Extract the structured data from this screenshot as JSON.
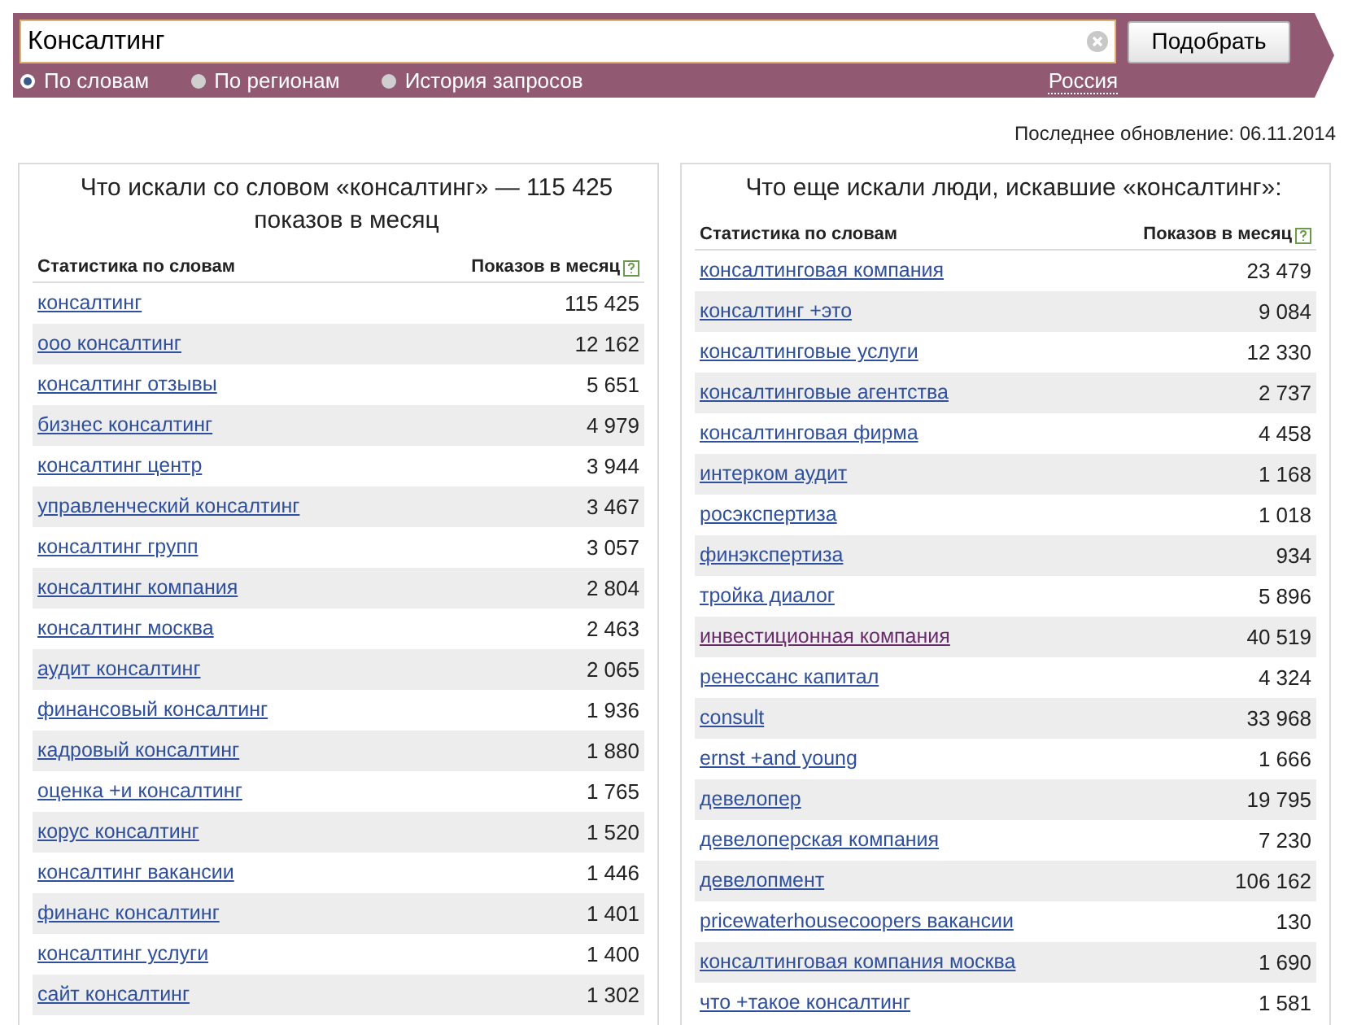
{
  "search": {
    "value": "Консалтинг",
    "button": "Подобрать"
  },
  "modes": [
    {
      "label": "По словам",
      "selected": true
    },
    {
      "label": "По регионам",
      "selected": false
    },
    {
      "label": "История запросов",
      "selected": false
    }
  ],
  "region": "Россия",
  "last_update": "Последнее обновление: 06.11.2014",
  "panels": [
    {
      "title": "Что искали со словом «консалтинг» — 115 425 показов в месяц",
      "columns": [
        "Статистика по словам",
        "Показов в месяц"
      ],
      "rows": [
        {
          "phrase": "консалтинг",
          "count": "115 425",
          "visited": false
        },
        {
          "phrase": "ооо консалтинг",
          "count": "12 162",
          "visited": false
        },
        {
          "phrase": "консалтинг отзывы",
          "count": "5 651",
          "visited": false
        },
        {
          "phrase": "бизнес консалтинг",
          "count": "4 979",
          "visited": false
        },
        {
          "phrase": "консалтинг центр",
          "count": "3 944",
          "visited": false
        },
        {
          "phrase": "управленческий консалтинг",
          "count": "3 467",
          "visited": false
        },
        {
          "phrase": "консалтинг групп",
          "count": "3 057",
          "visited": false
        },
        {
          "phrase": "консалтинг компания",
          "count": "2 804",
          "visited": false
        },
        {
          "phrase": "консалтинг москва",
          "count": "2 463",
          "visited": false
        },
        {
          "phrase": "аудит консалтинг",
          "count": "2 065",
          "visited": false
        },
        {
          "phrase": "финансовый консалтинг",
          "count": "1 936",
          "visited": false
        },
        {
          "phrase": "кадровый консалтинг",
          "count": "1 880",
          "visited": false
        },
        {
          "phrase": "оценка +и консалтинг",
          "count": "1 765",
          "visited": false
        },
        {
          "phrase": "корус консалтинг",
          "count": "1 520",
          "visited": false
        },
        {
          "phrase": "консалтинг вакансии",
          "count": "1 446",
          "visited": false
        },
        {
          "phrase": "финанс консалтинг",
          "count": "1 401",
          "visited": false
        },
        {
          "phrase": "консалтинг услуги",
          "count": "1 400",
          "visited": false
        },
        {
          "phrase": "сайт консалтинг",
          "count": "1 302",
          "visited": false
        }
      ]
    },
    {
      "title": "Что еще искали люди, искавшие «консалтинг»:",
      "columns": [
        "Статистика по словам",
        "Показов в месяц"
      ],
      "rows": [
        {
          "phrase": "консалтинговая компания",
          "count": "23 479",
          "visited": false
        },
        {
          "phrase": "консалтинг +это",
          "count": "9 084",
          "visited": false
        },
        {
          "phrase": "консалтинговые услуги",
          "count": "12 330",
          "visited": false
        },
        {
          "phrase": "консалтинговые агентства",
          "count": "2 737",
          "visited": false
        },
        {
          "phrase": "консалтинговая фирма",
          "count": "4 458",
          "visited": false
        },
        {
          "phrase": "интерком аудит",
          "count": "1 168",
          "visited": false
        },
        {
          "phrase": "росэкспертиза",
          "count": "1 018",
          "visited": false
        },
        {
          "phrase": "финэкспертиза",
          "count": "934",
          "visited": false
        },
        {
          "phrase": "тройка диалог",
          "count": "5 896",
          "visited": false
        },
        {
          "phrase": "инвестиционная компания",
          "count": "40 519",
          "visited": true
        },
        {
          "phrase": "ренессанс капитал",
          "count": "4 324",
          "visited": false
        },
        {
          "phrase": "consult",
          "count": "33 968",
          "visited": false
        },
        {
          "phrase": "ernst +and young",
          "count": "1 666",
          "visited": false
        },
        {
          "phrase": "девелопер",
          "count": "19 795",
          "visited": false
        },
        {
          "phrase": "девелоперская компания",
          "count": "7 230",
          "visited": false
        },
        {
          "phrase": "девелопмент",
          "count": "106 162",
          "visited": false
        },
        {
          "phrase": "pricewaterhousecoopers вакансии",
          "count": "130",
          "visited": false
        },
        {
          "phrase": "консалтинговая компания москва",
          "count": "1 690",
          "visited": false
        },
        {
          "phrase": "что +такое консалтинг",
          "count": "1 581",
          "visited": false
        }
      ]
    }
  ]
}
